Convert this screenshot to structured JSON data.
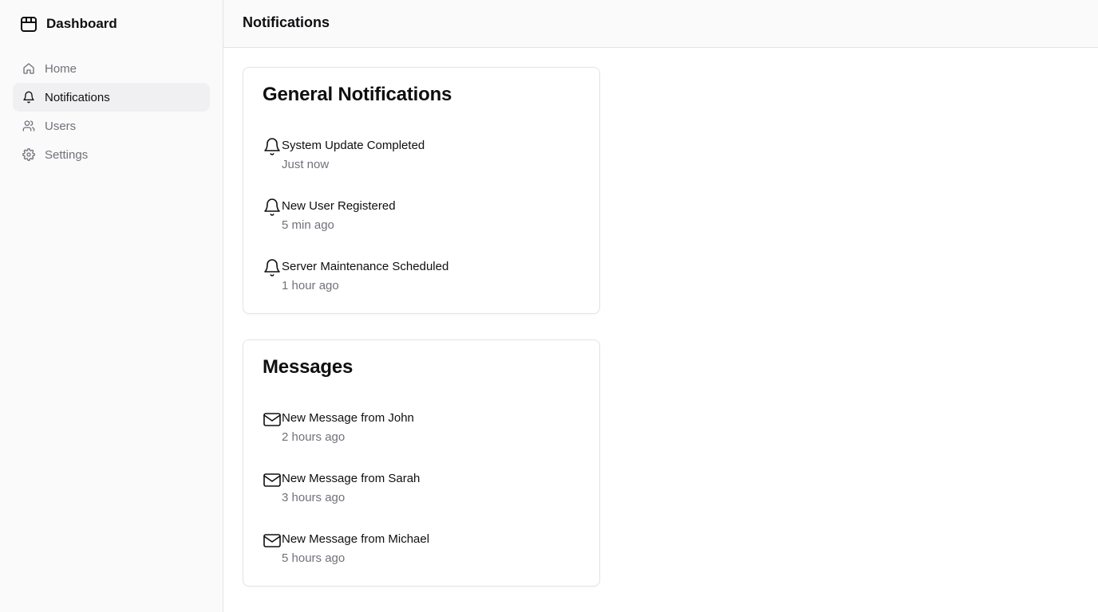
{
  "sidebar": {
    "brand_title": "Dashboard",
    "brand_icon": "package-icon",
    "items": [
      {
        "label": "Home",
        "icon": "home-icon",
        "active": false
      },
      {
        "label": "Notifications",
        "icon": "bell-icon",
        "active": true
      },
      {
        "label": "Users",
        "icon": "users-icon",
        "active": false
      },
      {
        "label": "Settings",
        "icon": "gear-icon",
        "active": false
      }
    ]
  },
  "header": {
    "title": "Notifications"
  },
  "general": {
    "title": "General Notifications",
    "items": [
      {
        "title": "System Update Completed",
        "time": "Just now"
      },
      {
        "title": "New User Registered",
        "time": "5 min ago"
      },
      {
        "title": "Server Maintenance Scheduled",
        "time": "1 hour ago"
      }
    ]
  },
  "messages": {
    "title": "Messages",
    "items": [
      {
        "title": "New Message from John",
        "time": "2 hours ago"
      },
      {
        "title": "New Message from Sarah",
        "time": "3 hours ago"
      },
      {
        "title": "New Message from Michael",
        "time": "5 hours ago"
      }
    ]
  },
  "colors": {
    "text": "#0f0f12",
    "muted": "#71717a",
    "active_bg": "#f0f0f2",
    "border": "#e4e4e7",
    "sidebar_bg": "#fafafa"
  }
}
